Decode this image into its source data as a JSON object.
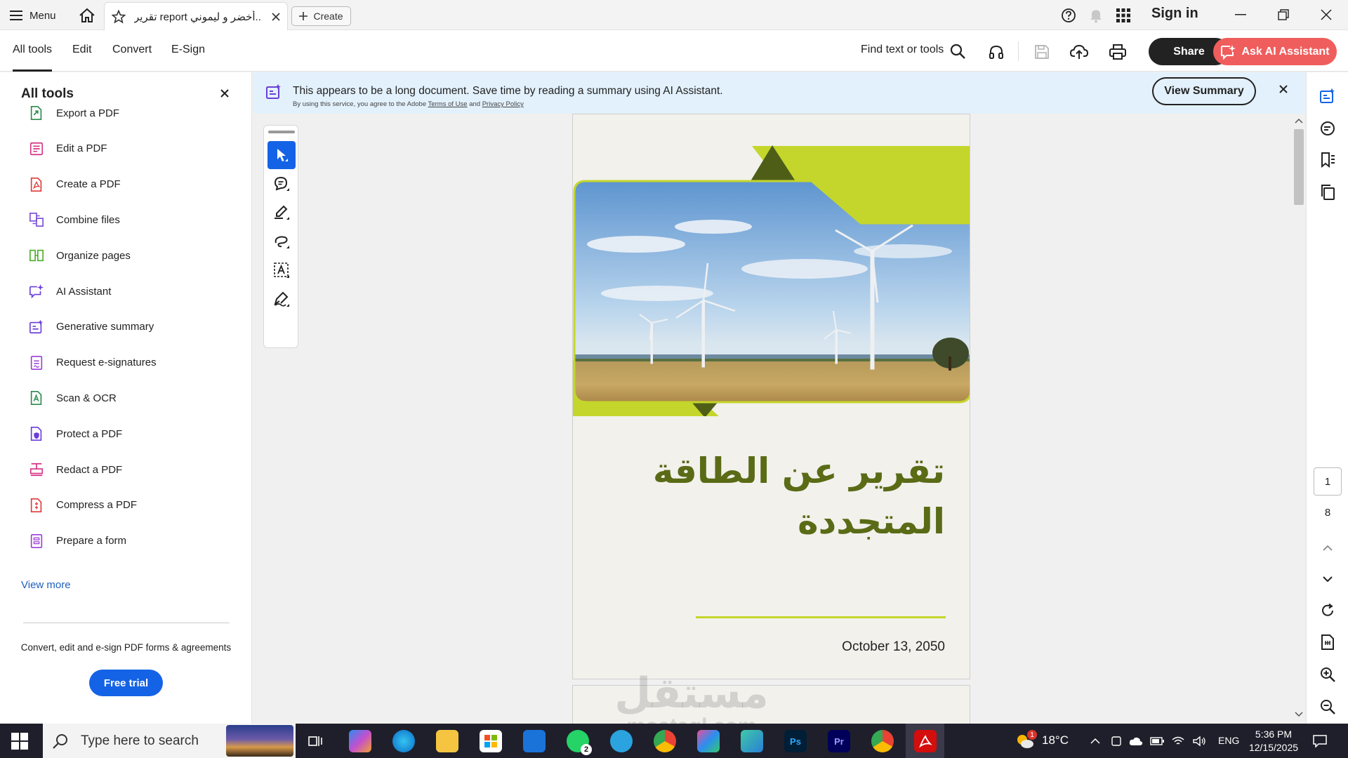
{
  "titlebar": {
    "menu_label": "Menu",
    "tab_title": "تقرير report أخضر و ليموني..",
    "create_label": "Create",
    "sign_in": "Sign in"
  },
  "toolbar": {
    "tabs": [
      {
        "label": "All tools",
        "active": true
      },
      {
        "label": "Edit",
        "active": false
      },
      {
        "label": "Convert",
        "active": false
      },
      {
        "label": "E-Sign",
        "active": false
      }
    ],
    "find_label": "Find text or tools",
    "share_label": "Share",
    "ai_label": "Ask AI Assistant"
  },
  "left_panel": {
    "title": "All tools",
    "items": [
      {
        "label": "Export a PDF",
        "icon": "export-pdf-icon",
        "color": "#2d8a4e"
      },
      {
        "label": "Edit a PDF",
        "icon": "edit-pdf-icon",
        "color": "#d63384"
      },
      {
        "label": "Create a PDF",
        "icon": "create-pdf-icon",
        "color": "#e03a3a"
      },
      {
        "label": "Combine files",
        "icon": "combine-files-icon",
        "color": "#7b4fd6"
      },
      {
        "label": "Organize pages",
        "icon": "organize-pages-icon",
        "color": "#4caf2a"
      },
      {
        "label": "AI Assistant",
        "icon": "ai-assistant-icon",
        "color": "#6a3fd9"
      },
      {
        "label": "Generative summary",
        "icon": "generative-summary-icon",
        "color": "#6a3fd9"
      },
      {
        "label": "Request e-signatures",
        "icon": "request-esignatures-icon",
        "color": "#9b3fd6"
      },
      {
        "label": "Scan & OCR",
        "icon": "scan-ocr-icon",
        "color": "#2d8a4e"
      },
      {
        "label": "Protect a PDF",
        "icon": "protect-pdf-icon",
        "color": "#6a3fd9"
      },
      {
        "label": "Redact a PDF",
        "icon": "redact-pdf-icon",
        "color": "#d63384"
      },
      {
        "label": "Compress a PDF",
        "icon": "compress-pdf-icon",
        "color": "#e03a3a"
      },
      {
        "label": "Prepare a form",
        "icon": "prepare-form-icon",
        "color": "#9b3fd6"
      }
    ],
    "view_more": "View more",
    "promo_text": "Convert, edit and e-sign PDF forms & agreements",
    "free_trial": "Free trial"
  },
  "banner": {
    "main_text": "This appears to be a long document. Save time by reading a summary using AI Assistant.",
    "sub_prefix": "By using this service, you agree to the Adobe",
    "terms_link": "Terms of Use",
    "and_text": "and",
    "privacy_link": "Privacy Policy",
    "view_summary": "View Summary"
  },
  "document": {
    "title_line1": "تقرير عن الطاقة",
    "title_line2": "المتجددة",
    "date": "October 13, 2050",
    "accent_color": "#c4d62b",
    "dark_green": "#4f5e17"
  },
  "watermark": {
    "text": "مستقل",
    "sub": "mostaql.com"
  },
  "right_rail": {
    "current_page": "1",
    "total_pages": "8"
  },
  "taskbar": {
    "search_placeholder": "Type here to search",
    "weather": "18°C",
    "language": "ENG",
    "time": "5:36 PM",
    "date": "12/15/2025",
    "whatsapp_badge": "2",
    "weather_badge": "1"
  }
}
